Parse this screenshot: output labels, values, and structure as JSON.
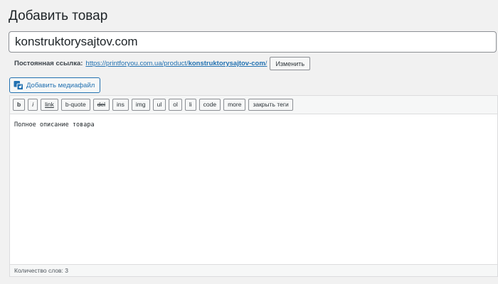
{
  "header": {
    "title": "Добавить товар"
  },
  "product": {
    "title_value": "konstruktorysajtov.com"
  },
  "permalink": {
    "label": "Постоянная ссылка:",
    "url_base": "https://printforyou.com.ua/product/",
    "url_slug": "konstruktorysajtov-com",
    "url_end": "/",
    "change_label": "Изменить"
  },
  "media": {
    "add_label": "Добавить медиафайл",
    "icon": "media-add-icon"
  },
  "toolbar": {
    "buttons": [
      "b",
      "i",
      "link",
      "b-quote",
      "del",
      "ins",
      "img",
      "ul",
      "ol",
      "li",
      "code",
      "more",
      "закрыть теги"
    ]
  },
  "editor": {
    "content": "Полное описание товара"
  },
  "status": {
    "word_count": "Количество слов: 3"
  },
  "colors": {
    "accent": "#2271b1",
    "border": "#8c8f94",
    "background": "#f1f1f1"
  }
}
